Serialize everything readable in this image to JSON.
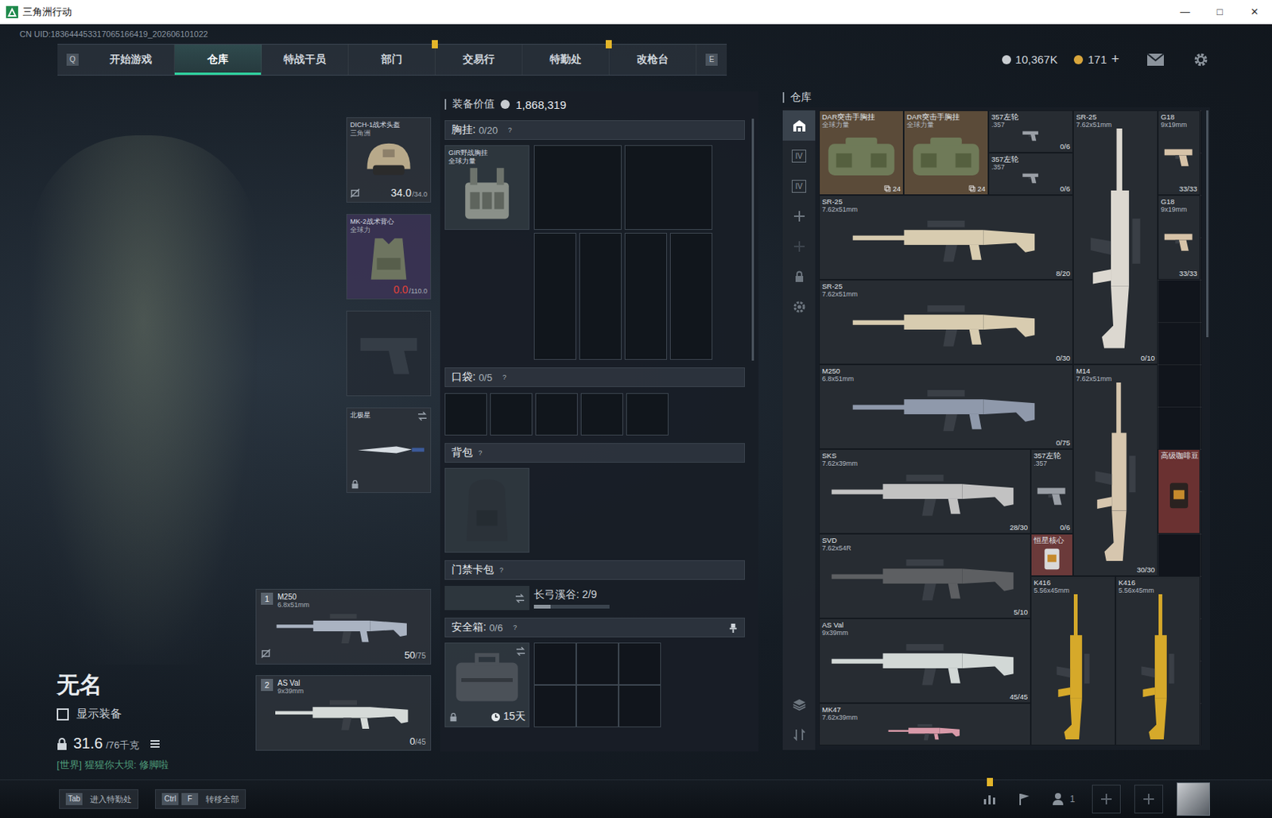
{
  "window": {
    "title": "三角洲行动",
    "controls": [
      "—",
      "□",
      "✕"
    ]
  },
  "uid": "CN UID:183644453317065166419_202606101022",
  "nav": {
    "keys": [
      "Q",
      "E"
    ],
    "tabs": [
      {
        "label": "开始游戏",
        "selected": false,
        "alert": false
      },
      {
        "label": "仓库",
        "selected": true,
        "alert": false
      },
      {
        "label": "特战干员",
        "selected": false,
        "alert": false
      },
      {
        "label": "部门",
        "selected": false,
        "alert": true
      },
      {
        "label": "交易行",
        "selected": false,
        "alert": false
      },
      {
        "label": "特勤处",
        "selected": false,
        "alert": true
      },
      {
        "label": "改枪台",
        "selected": false,
        "alert": false
      }
    ]
  },
  "currency": [
    {
      "value": "10,367K",
      "action": "",
      "color": "#c8ccd0"
    },
    {
      "value": "171",
      "action": "+",
      "color": "#d9a63c"
    }
  ],
  "character": {
    "name": "无名",
    "show_equipment": {
      "label": "显示装备",
      "checked": false
    },
    "weight": {
      "value": "31.6",
      "max": "/76千克"
    },
    "chat": "[世界] 猩猩你大坝: 修脚啦"
  },
  "equipment": {
    "helmet": {
      "name": "DICH-1战术头盔",
      "sub": "三角洲",
      "value": "34.0",
      "max": "/34.0",
      "broken": false,
      "no_repair": true
    },
    "armor": {
      "name": "MK-2战术背心",
      "sub": "全球力",
      "value": "0.0",
      "max": "/110.0",
      "broken": true,
      "no_repair": false
    },
    "melee": {
      "name": "北极星",
      "locked": true
    },
    "weapons": [
      {
        "slot": "1",
        "name": "M250",
        "caliber": "6.8x51mm",
        "ammo": "50",
        "max": "/75",
        "no_repair": true,
        "tint": "#aab3c2"
      },
      {
        "slot": "2",
        "name": "AS Val",
        "caliber": "9x39mm",
        "ammo": "0",
        "max": "/45",
        "no_repair": false,
        "tint": "#d5dad8"
      }
    ]
  },
  "loadout": {
    "value_label": "装备价值",
    "value": "1,868,319",
    "chest": {
      "label": "胸挂:",
      "count": "0/20",
      "help": "?",
      "item": {
        "name": "GIR野战胸挂",
        "sub": "全球力量"
      }
    },
    "pockets": {
      "label": "口袋:",
      "count": "0/5",
      "help": "?"
    },
    "backpack": {
      "label": "背包",
      "help": "?"
    },
    "keycard": {
      "label": "门禁卡包",
      "help": "?",
      "text": "长弓溪谷: 2/9",
      "level": 0.22
    },
    "safe": {
      "label": "安全箱:",
      "count": "0/6",
      "help": "?",
      "days": "15天",
      "locked": true
    }
  },
  "stash": {
    "title": "仓库",
    "sidebar": [
      {
        "selected": true,
        "disabled": false,
        "label": ""
      },
      {
        "selected": false,
        "disabled": false,
        "label": "IV"
      },
      {
        "selected": false,
        "disabled": false,
        "label": "IV"
      },
      {
        "selected": false,
        "disabled": false,
        "label": ""
      },
      {
        "selected": false,
        "disabled": true,
        "label": ""
      },
      {
        "selected": false,
        "disabled": false,
        "label": ""
      },
      {
        "selected": false,
        "disabled": false,
        "label": ""
      }
    ],
    "tools": [
      {
        "selected": false
      },
      {
        "selected": false
      }
    ],
    "items": [
      {
        "name": "DAR突击手胸挂",
        "caliber": "全球力量",
        "count": "24",
        "kind": "rig",
        "color": "#5b4b39",
        "tint": "#6f7a58"
      },
      {
        "name": "DAR突击手胸挂",
        "caliber": "全球力量",
        "count": "24",
        "kind": "rig",
        "color": "#5b4b39",
        "tint": "#6f7a58"
      },
      {
        "name": "357左轮",
        "caliber": ".357",
        "count": "0/6",
        "kind": "pistol",
        "color": "#272c32",
        "tint": "#9a9fa6"
      },
      {
        "name": "357左轮",
        "caliber": ".357",
        "count": "0/6",
        "kind": "pistol",
        "color": "#272c32",
        "tint": "#9a9fa6"
      },
      {
        "name": "SR-25",
        "caliber": "7.62x51mm",
        "count": "0/10",
        "kind": "rifle-v",
        "color": "#272c32",
        "tint": "#dcd8d0"
      },
      {
        "name": "G18",
        "caliber": "9x19mm",
        "count": "33/33",
        "kind": "pistol",
        "color": "#272c32",
        "tint": "#d7c3a8"
      },
      {
        "name": "SR-25",
        "caliber": "7.62x51mm",
        "count": "8/20",
        "kind": "rifle",
        "color": "#272c32",
        "tint": "#d8ccb0"
      },
      {
        "name": "G18",
        "caliber": "9x19mm",
        "count": "33/33",
        "kind": "pistol",
        "color": "#272c32",
        "tint": "#d7c3a8"
      },
      {
        "name": "SR-25",
        "caliber": "7.62x51mm",
        "count": "0/30",
        "kind": "rifle",
        "color": "#272c32",
        "tint": "#d8ccb0"
      },
      {
        "name": "M250",
        "caliber": "6.8x51mm",
        "count": "0/75",
        "kind": "rifle",
        "color": "#272c32",
        "tint": "#8f99ab"
      },
      {
        "name": "M14",
        "caliber": "7.62x51mm",
        "count": "30/30",
        "kind": "rifle-v",
        "color": "#272c32",
        "tint": "#d6c6ae"
      },
      {
        "name": "SKS",
        "caliber": "7.62x39mm",
        "count": "28/30",
        "kind": "rifle",
        "color": "#272c32",
        "tint": "#c2c2c2"
      },
      {
        "name": "357左轮",
        "caliber": ".357",
        "count": "0/6",
        "kind": "pistol",
        "color": "#272c32",
        "tint": "#9a9fa6"
      },
      {
        "name": "高级咖啡豆",
        "kind": "misc",
        "color": "#6a3131",
        "tint": "#2a2220"
      },
      {
        "name": "SVD",
        "caliber": "7.62x54R",
        "count": "5/10",
        "kind": "rifle",
        "color": "#272c32",
        "tint": "#5d5f62"
      },
      {
        "name": "恒星核心",
        "kind": "misc",
        "color": "#6b3a3a",
        "tint": "#d9d9d9"
      },
      {
        "name": "K416",
        "caliber": "5.56x45mm",
        "kind": "rifle-v",
        "color": "#272c32",
        "tint": "#d6a92a"
      },
      {
        "name": "K416",
        "caliber": "5.56x45mm",
        "kind": "rifle-v",
        "color": "#272c32",
        "tint": "#d6a92a"
      },
      {
        "name": "AS Val",
        "caliber": "9x39mm",
        "count": "45/45",
        "kind": "rifle",
        "color": "#272c32",
        "tint": "#d2d8d6"
      },
      {
        "name": "MK47",
        "caliber": "7.62x39mm",
        "kind": "rifle",
        "color": "#272c32",
        "tint": "#d99aa9"
      }
    ]
  },
  "bottom": {
    "hints": [
      {
        "keys": [
          "Tab"
        ],
        "label": "进入特勤处"
      },
      {
        "keys": [
          "Ctrl",
          "F"
        ],
        "label": "转移全部"
      }
    ],
    "squad": "1",
    "alert": true
  }
}
